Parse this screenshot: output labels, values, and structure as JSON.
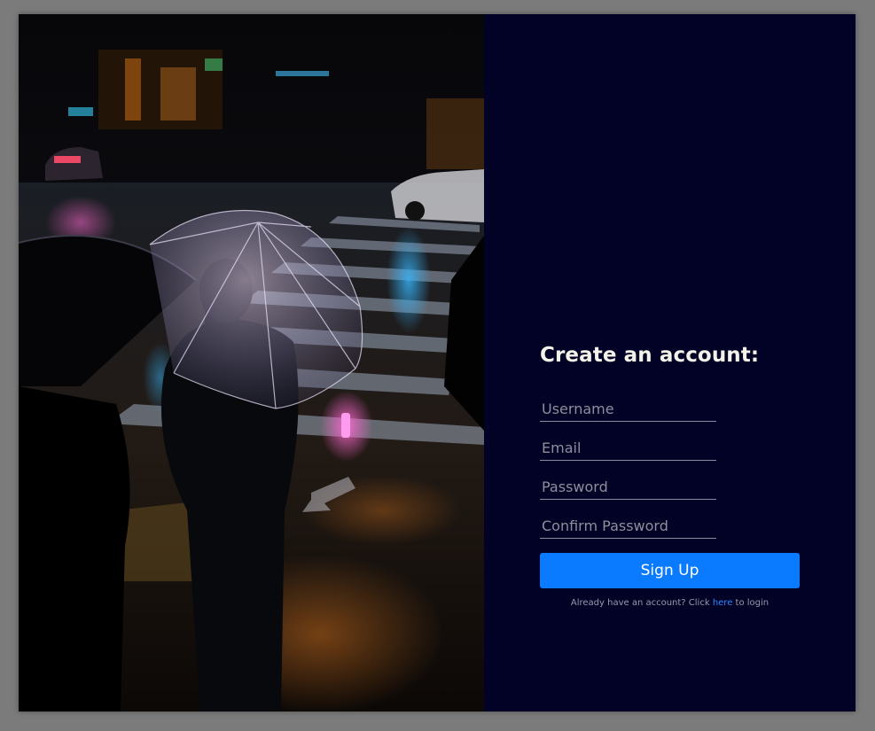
{
  "form": {
    "title": "Create an account:",
    "username_placeholder": "Username",
    "email_placeholder": "Email",
    "password_placeholder": "Password",
    "confirm_placeholder": "Confirm Password",
    "signup_label": "Sign Up",
    "login_prefix": "Already have an account? Click ",
    "login_link": "here",
    "login_suffix": " to login"
  },
  "colors": {
    "page_bg": "#7b7b7b",
    "panel_bg": "#020126",
    "button_bg": "#0a7bff",
    "link": "#2d8cff",
    "title": "#f2f2e8"
  },
  "photo": {
    "subject": "person-with-clear-umbrella-at-rainy-night-crosswalk"
  }
}
